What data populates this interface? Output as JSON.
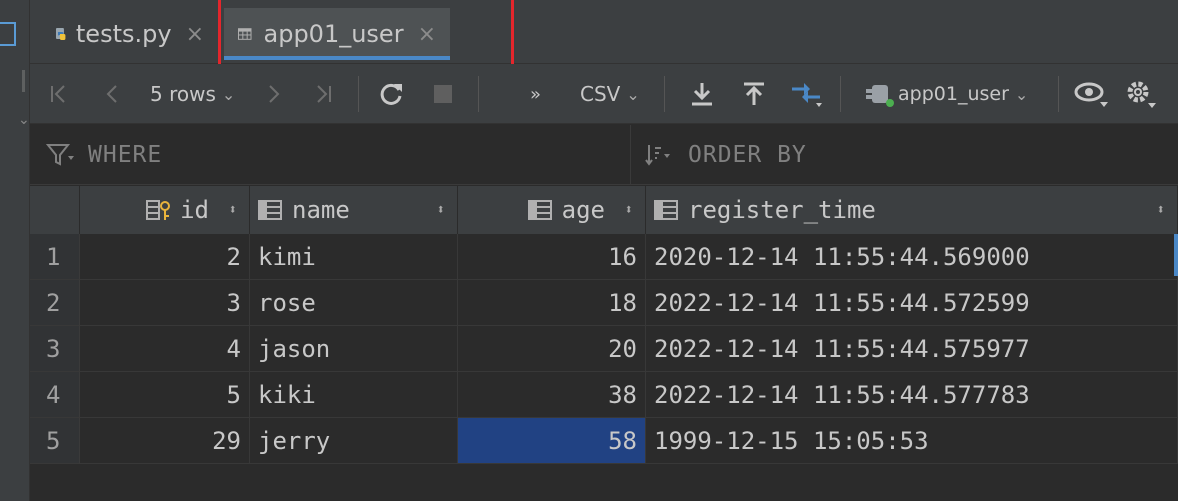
{
  "tabs": [
    {
      "label": "tests.py",
      "icon": "python-file-icon",
      "active": false
    },
    {
      "label": "app01_user",
      "icon": "table-icon",
      "active": true
    }
  ],
  "toolbar": {
    "rows_label": "5 rows",
    "more_label": "»",
    "export_format": "CSV",
    "datasource_label": "app01_user"
  },
  "filter": {
    "where_label": "WHERE",
    "order_label": "ORDER BY"
  },
  "columns": [
    {
      "name": "id"
    },
    {
      "name": "name"
    },
    {
      "name": "age"
    },
    {
      "name": "register_time"
    }
  ],
  "rows": [
    {
      "n": "1",
      "id": "2",
      "name": "kimi",
      "age": "16",
      "register_time": "2020-12-14 11:55:44.569000"
    },
    {
      "n": "2",
      "id": "3",
      "name": "rose",
      "age": "18",
      "register_time": "2022-12-14 11:55:44.572599"
    },
    {
      "n": "3",
      "id": "4",
      "name": "jason",
      "age": "20",
      "register_time": "2022-12-14 11:55:44.575977"
    },
    {
      "n": "4",
      "id": "5",
      "name": "kiki",
      "age": "38",
      "register_time": "2022-12-14 11:55:44.577783"
    },
    {
      "n": "5",
      "id": "29",
      "name": "jerry",
      "age": "58",
      "register_time": "1999-12-15 15:05:53"
    }
  ],
  "colors": {
    "background": "#2b2b2b",
    "panel": "#3c3f41",
    "selection": "#214283",
    "accent": "#4a88c7",
    "highlight_box": "#e4262c"
  }
}
